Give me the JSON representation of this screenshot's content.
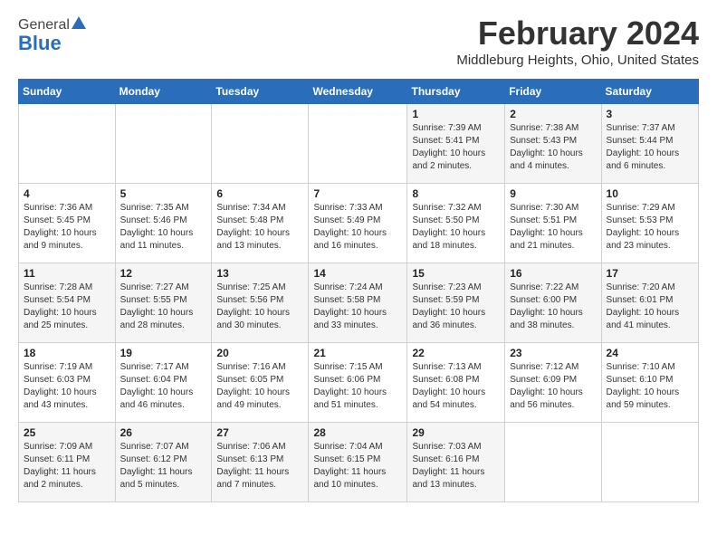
{
  "header": {
    "logo_general": "General",
    "logo_blue": "Blue",
    "month_year": "February 2024",
    "location": "Middleburg Heights, Ohio, United States"
  },
  "days_of_week": [
    "Sunday",
    "Monday",
    "Tuesday",
    "Wednesday",
    "Thursday",
    "Friday",
    "Saturday"
  ],
  "weeks": [
    [
      {
        "day": "",
        "info": ""
      },
      {
        "day": "",
        "info": ""
      },
      {
        "day": "",
        "info": ""
      },
      {
        "day": "",
        "info": ""
      },
      {
        "day": "1",
        "info": "Sunrise: 7:39 AM\nSunset: 5:41 PM\nDaylight: 10 hours and 2 minutes."
      },
      {
        "day": "2",
        "info": "Sunrise: 7:38 AM\nSunset: 5:43 PM\nDaylight: 10 hours and 4 minutes."
      },
      {
        "day": "3",
        "info": "Sunrise: 7:37 AM\nSunset: 5:44 PM\nDaylight: 10 hours and 6 minutes."
      }
    ],
    [
      {
        "day": "4",
        "info": "Sunrise: 7:36 AM\nSunset: 5:45 PM\nDaylight: 10 hours and 9 minutes."
      },
      {
        "day": "5",
        "info": "Sunrise: 7:35 AM\nSunset: 5:46 PM\nDaylight: 10 hours and 11 minutes."
      },
      {
        "day": "6",
        "info": "Sunrise: 7:34 AM\nSunset: 5:48 PM\nDaylight: 10 hours and 13 minutes."
      },
      {
        "day": "7",
        "info": "Sunrise: 7:33 AM\nSunset: 5:49 PM\nDaylight: 10 hours and 16 minutes."
      },
      {
        "day": "8",
        "info": "Sunrise: 7:32 AM\nSunset: 5:50 PM\nDaylight: 10 hours and 18 minutes."
      },
      {
        "day": "9",
        "info": "Sunrise: 7:30 AM\nSunset: 5:51 PM\nDaylight: 10 hours and 21 minutes."
      },
      {
        "day": "10",
        "info": "Sunrise: 7:29 AM\nSunset: 5:53 PM\nDaylight: 10 hours and 23 minutes."
      }
    ],
    [
      {
        "day": "11",
        "info": "Sunrise: 7:28 AM\nSunset: 5:54 PM\nDaylight: 10 hours and 25 minutes."
      },
      {
        "day": "12",
        "info": "Sunrise: 7:27 AM\nSunset: 5:55 PM\nDaylight: 10 hours and 28 minutes."
      },
      {
        "day": "13",
        "info": "Sunrise: 7:25 AM\nSunset: 5:56 PM\nDaylight: 10 hours and 30 minutes."
      },
      {
        "day": "14",
        "info": "Sunrise: 7:24 AM\nSunset: 5:58 PM\nDaylight: 10 hours and 33 minutes."
      },
      {
        "day": "15",
        "info": "Sunrise: 7:23 AM\nSunset: 5:59 PM\nDaylight: 10 hours and 36 minutes."
      },
      {
        "day": "16",
        "info": "Sunrise: 7:22 AM\nSunset: 6:00 PM\nDaylight: 10 hours and 38 minutes."
      },
      {
        "day": "17",
        "info": "Sunrise: 7:20 AM\nSunset: 6:01 PM\nDaylight: 10 hours and 41 minutes."
      }
    ],
    [
      {
        "day": "18",
        "info": "Sunrise: 7:19 AM\nSunset: 6:03 PM\nDaylight: 10 hours and 43 minutes."
      },
      {
        "day": "19",
        "info": "Sunrise: 7:17 AM\nSunset: 6:04 PM\nDaylight: 10 hours and 46 minutes."
      },
      {
        "day": "20",
        "info": "Sunrise: 7:16 AM\nSunset: 6:05 PM\nDaylight: 10 hours and 49 minutes."
      },
      {
        "day": "21",
        "info": "Sunrise: 7:15 AM\nSunset: 6:06 PM\nDaylight: 10 hours and 51 minutes."
      },
      {
        "day": "22",
        "info": "Sunrise: 7:13 AM\nSunset: 6:08 PM\nDaylight: 10 hours and 54 minutes."
      },
      {
        "day": "23",
        "info": "Sunrise: 7:12 AM\nSunset: 6:09 PM\nDaylight: 10 hours and 56 minutes."
      },
      {
        "day": "24",
        "info": "Sunrise: 7:10 AM\nSunset: 6:10 PM\nDaylight: 10 hours and 59 minutes."
      }
    ],
    [
      {
        "day": "25",
        "info": "Sunrise: 7:09 AM\nSunset: 6:11 PM\nDaylight: 11 hours and 2 minutes."
      },
      {
        "day": "26",
        "info": "Sunrise: 7:07 AM\nSunset: 6:12 PM\nDaylight: 11 hours and 5 minutes."
      },
      {
        "day": "27",
        "info": "Sunrise: 7:06 AM\nSunset: 6:13 PM\nDaylight: 11 hours and 7 minutes."
      },
      {
        "day": "28",
        "info": "Sunrise: 7:04 AM\nSunset: 6:15 PM\nDaylight: 11 hours and 10 minutes."
      },
      {
        "day": "29",
        "info": "Sunrise: 7:03 AM\nSunset: 6:16 PM\nDaylight: 11 hours and 13 minutes."
      },
      {
        "day": "",
        "info": ""
      },
      {
        "day": "",
        "info": ""
      }
    ]
  ]
}
